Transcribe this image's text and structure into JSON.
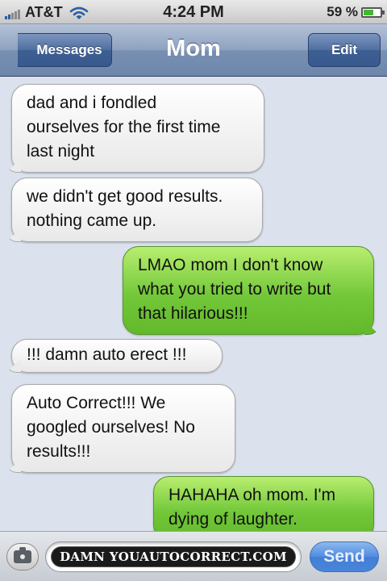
{
  "status_bar": {
    "carrier": "AT&T",
    "time": "4:24 PM",
    "battery_percent": "59 %",
    "battery_level": 0.59,
    "signal_bars": 2
  },
  "nav": {
    "back_label": "Messages",
    "title": "Mom",
    "edit_label": "Edit"
  },
  "messages": [
    {
      "side": "incoming",
      "text": "dad and i fondled\nourselves for the first time\nlast night"
    },
    {
      "side": "incoming",
      "text": "we didn't get good results.\nnothing came up."
    },
    {
      "side": "outgoing",
      "text": "LMAO mom I don't know\nwhat you tried to write but\nthat hilarious!!!"
    },
    {
      "side": "incoming",
      "text": "!!! damn auto erect !!!"
    },
    {
      "side": "incoming",
      "text": "Auto Correct!!! We\ngoogled ourselves! No\nresults!!!"
    },
    {
      "side": "outgoing",
      "text": "HAHAHA oh mom. I'm\ndying of laughter."
    }
  ],
  "input": {
    "watermark": "DAMN YOUAUTOCORRECT.COM",
    "send_label": "Send"
  },
  "icons": {
    "camera": "camera-icon",
    "wifi": "wifi-icon",
    "battery": "battery-icon",
    "signal": "signal-icon"
  },
  "colors": {
    "incoming_bubble": "#ffffff",
    "outgoing_bubble": "#73c83a",
    "nav_bar": "#8ea2bf",
    "background": "#dbe2ed",
    "send_button": "#3a7fe0"
  }
}
